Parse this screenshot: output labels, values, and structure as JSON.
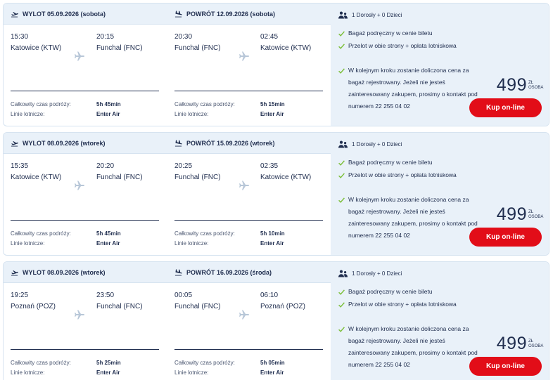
{
  "labels": {
    "total_time": "Całkowity czas podróży:",
    "airline": "Linie lotnicze:",
    "check_icon": "check-icon",
    "plane_icon": "plane-icon"
  },
  "colors": {
    "accent": "#e20d18",
    "navy": "#1f2d4e",
    "panel": "#e9f1f9",
    "check": "#7cbf3a"
  },
  "offers": [
    {
      "outbound_title": "WYLOT 05.09.2026 (sobota)",
      "return_title": "POWRÓT 12.09.2026 (sobota)",
      "out": {
        "dep_time": "15:30",
        "arr_time": "20:15",
        "dep_city": "Katowice (KTW)",
        "arr_city": "Funchal (FNC)",
        "duration": "5h 45min",
        "airline": "Enter Air"
      },
      "ret": {
        "dep_time": "20:30",
        "arr_time": "02:45",
        "dep_city": "Funchal (FNC)",
        "arr_city": "Katowice (KTW)",
        "duration": "5h 15min",
        "airline": "Enter Air"
      },
      "passengers": "1 Dorosły + 0 Dzieci",
      "features": [
        "Bagaż podręczny w cenie biletu",
        "Przelot w obie strony + opłata lotniskowa",
        "W kolejnym kroku zostanie doliczona cena za bagaż rejestrowany. Jeżeli nie jesteś zainteresowany zakupem, prosimy o kontakt pod numerem 22 255 04 02"
      ],
      "price": "499",
      "currency": "ZŁ",
      "per": "OSOBA",
      "buy_label": "Kup on-line"
    },
    {
      "outbound_title": "WYLOT 08.09.2026 (wtorek)",
      "return_title": "POWRÓT 15.09.2026 (wtorek)",
      "out": {
        "dep_time": "15:35",
        "arr_time": "20:20",
        "dep_city": "Katowice (KTW)",
        "arr_city": "Funchal (FNC)",
        "duration": "5h 45min",
        "airline": "Enter Air"
      },
      "ret": {
        "dep_time": "20:25",
        "arr_time": "02:35",
        "dep_city": "Funchal (FNC)",
        "arr_city": "Katowice (KTW)",
        "duration": "5h 10min",
        "airline": "Enter Air"
      },
      "passengers": "1 Dorosły + 0 Dzieci",
      "features": [
        "Bagaż podręczny w cenie biletu",
        "Przelot w obie strony + opłata lotniskowa",
        "W kolejnym kroku zostanie doliczona cena za bagaż rejestrowany. Jeżeli nie jesteś zainteresowany zakupem, prosimy o kontakt pod numerem 22 255 04 02"
      ],
      "price": "499",
      "currency": "ZŁ",
      "per": "OSOBA",
      "buy_label": "Kup on-line"
    },
    {
      "outbound_title": "WYLOT 08.09.2026 (wtorek)",
      "return_title": "POWRÓT 16.09.2026 (środa)",
      "out": {
        "dep_time": "19:25",
        "arr_time": "23:50",
        "dep_city": "Poznań (POZ)",
        "arr_city": "Funchal (FNC)",
        "duration": "5h 25min",
        "airline": "Enter Air"
      },
      "ret": {
        "dep_time": "00:05",
        "arr_time": "06:10",
        "dep_city": "Funchal (FNC)",
        "arr_city": "Poznań (POZ)",
        "duration": "5h 05min",
        "airline": "Enter Air"
      },
      "passengers": "1 Dorosły + 0 Dzieci",
      "features": [
        "Bagaż podręczny w cenie biletu",
        "Przelot w obie strony + opłata lotniskowa",
        "W kolejnym kroku zostanie doliczona cena za bagaż rejestrowany. Jeżeli nie jesteś zainteresowany zakupem, prosimy o kontakt pod numerem 22 255 04 02"
      ],
      "price": "499",
      "currency": "ZŁ",
      "per": "OSOBA",
      "buy_label": "Kup on-line"
    }
  ]
}
